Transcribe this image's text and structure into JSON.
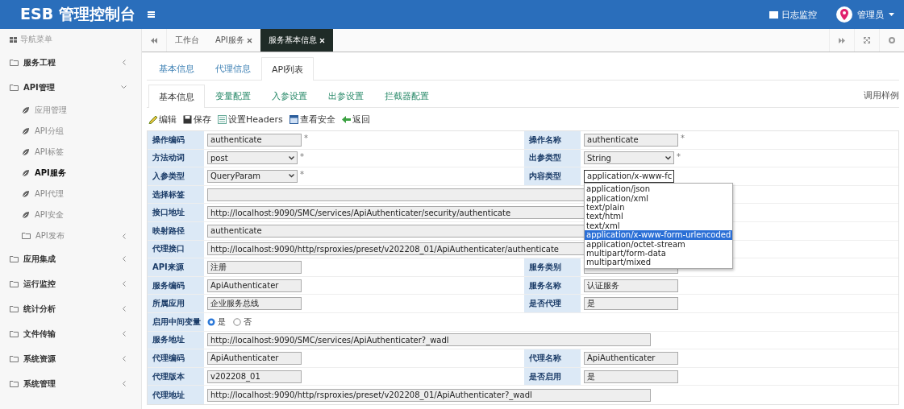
{
  "header": {
    "title": "ESB 管理控制台",
    "log_link": "日志监控",
    "user": "管理员"
  },
  "sidebar": {
    "title": "导航菜单",
    "items": [
      {
        "label": "服务工程",
        "kind": "group",
        "expanded": false,
        "selected": false
      },
      {
        "label": "API管理",
        "kind": "group",
        "expanded": true,
        "selected": false,
        "children": [
          {
            "label": "应用管理",
            "kind": "leaf",
            "selected": false
          },
          {
            "label": "API分组",
            "kind": "leaf",
            "selected": false
          },
          {
            "label": "API标签",
            "kind": "leaf",
            "selected": false
          },
          {
            "label": "API服务",
            "kind": "leaf",
            "selected": true
          },
          {
            "label": "API代理",
            "kind": "leaf",
            "selected": false
          },
          {
            "label": "API安全",
            "kind": "leaf",
            "selected": false
          },
          {
            "label": "API发布",
            "kind": "group",
            "expanded": false,
            "selected": false
          }
        ]
      },
      {
        "label": "应用集成",
        "kind": "group",
        "expanded": false,
        "selected": false
      },
      {
        "label": "运行监控",
        "kind": "group",
        "expanded": false,
        "selected": false
      },
      {
        "label": "统计分析",
        "kind": "group",
        "expanded": false,
        "selected": false
      },
      {
        "label": "文件传输",
        "kind": "group",
        "expanded": false,
        "selected": false
      },
      {
        "label": "系统资源",
        "kind": "group",
        "expanded": false,
        "selected": false
      },
      {
        "label": "系统管理",
        "kind": "group",
        "expanded": false,
        "selected": false
      }
    ]
  },
  "page_tabs": [
    {
      "label": "工作台",
      "closable": false,
      "selected": false
    },
    {
      "label": "API服务",
      "closable": true,
      "selected": false
    },
    {
      "label": "服务基本信息",
      "closable": true,
      "selected": true
    }
  ],
  "tabs": [
    {
      "label": "基本信息",
      "selected": false
    },
    {
      "label": "代理信息",
      "selected": false
    },
    {
      "label": "API列表",
      "selected": true
    }
  ],
  "subtabs": [
    {
      "label": "基本信息",
      "selected": true
    },
    {
      "label": "变量配置",
      "selected": false
    },
    {
      "label": "入参设置",
      "selected": false
    },
    {
      "label": "出参设置",
      "selected": false
    },
    {
      "label": "拦截器配置",
      "selected": false
    }
  ],
  "example_link": "调用样例",
  "toolbar": [
    {
      "label": "编辑",
      "kind": "edit"
    },
    {
      "label": "保存",
      "kind": "save"
    },
    {
      "label": "设置Headers",
      "kind": "list"
    },
    {
      "label": "查看安全",
      "kind": "window"
    },
    {
      "label": "返回",
      "kind": "back"
    }
  ],
  "form": {
    "rows": [
      {
        "cells": [
          {
            "label": "操作编码",
            "kind": "input",
            "value": "authenticate",
            "mark": "*"
          },
          {
            "label": "操作名称",
            "kind": "input",
            "value": "authenticate",
            "mark": "*"
          }
        ]
      },
      {
        "cells": [
          {
            "label": "方法动词",
            "kind": "select",
            "value": "post",
            "open": false,
            "mark": "*"
          },
          {
            "label": "出参类型",
            "kind": "select",
            "value": "String",
            "open": false,
            "mark": "*"
          }
        ]
      },
      {
        "cells": [
          {
            "label": "入参类型",
            "kind": "select",
            "value": "QueryParam",
            "open": false,
            "mark": "*"
          },
          {
            "label": "内容类型",
            "kind": "select",
            "value": "application/x-www-fc",
            "open": true
          }
        ]
      },
      {
        "cells": [
          {
            "label": "选择标签",
            "kind": "wide"
          }
        ]
      },
      {
        "cells": [
          {
            "label": "接口地址",
            "kind": "wide",
            "value": "http://localhost:9090/SMC/services/ApiAuthenticater/security/authenticate"
          }
        ]
      },
      {
        "cells": [
          {
            "label": "映射路径",
            "kind": "wide",
            "value": "authenticate"
          }
        ]
      },
      {
        "cells": [
          {
            "label": "代理接口",
            "kind": "wide",
            "value": "http://localhost:9090/http/rsproxies/preset/v202208_01/ApiAuthenticater/authenticate"
          }
        ]
      },
      {
        "cells": [
          {
            "label": "API来源",
            "kind": "input",
            "value": "注册"
          },
          {
            "label": "服务类别",
            "kind": "input"
          }
        ]
      },
      {
        "cells": [
          {
            "label": "服务编码",
            "kind": "input",
            "value": "ApiAuthenticater"
          },
          {
            "label": "服务名称",
            "kind": "input",
            "value": "认证服务"
          }
        ]
      },
      {
        "cells": [
          {
            "label": "所属应用",
            "kind": "input",
            "value": "企业服务总线"
          },
          {
            "label": "是否代理",
            "kind": "input",
            "value": "是"
          }
        ]
      },
      {
        "cells": [
          {
            "label": "启用中间变量",
            "kind": "radio",
            "options": [
              {
                "label": "是",
                "selected": true
              },
              {
                "label": "否",
                "selected": false
              }
            ]
          }
        ]
      },
      {
        "cells": [
          {
            "label": "服务地址",
            "kind": "long",
            "value": "http://localhost:9090/SMC/services/ApiAuthenticater?_wadl"
          }
        ]
      },
      {
        "cells": [
          {
            "label": "代理编码",
            "kind": "input",
            "value": "ApiAuthenticater"
          },
          {
            "label": "代理名称",
            "kind": "input",
            "value": "ApiAuthenticater"
          }
        ]
      },
      {
        "cells": [
          {
            "label": "代理版本",
            "kind": "input",
            "value": "v202208_01"
          },
          {
            "label": "是否启用",
            "kind": "input",
            "value": "是"
          }
        ]
      },
      {
        "cells": [
          {
            "label": "代理地址",
            "kind": "long",
            "value": "http://localhost:9090/http/rsproxies/preset/v202208_01/ApiAuthenticater?_wadl"
          }
        ]
      }
    ],
    "dropdown_menu": {
      "options": [
        {
          "label": "application/json",
          "selected": false
        },
        {
          "label": "application/xml",
          "selected": false
        },
        {
          "label": "text/plain",
          "selected": false
        },
        {
          "label": "text/html",
          "selected": false
        },
        {
          "label": "text/xml",
          "selected": false
        },
        {
          "label": "application/x-www-form-urlencoded",
          "selected": true
        },
        {
          "label": "application/octet-stream",
          "selected": false
        },
        {
          "label": "multipart/form-data",
          "selected": false
        },
        {
          "label": "multipart/mixed",
          "selected": false
        }
      ]
    }
  }
}
